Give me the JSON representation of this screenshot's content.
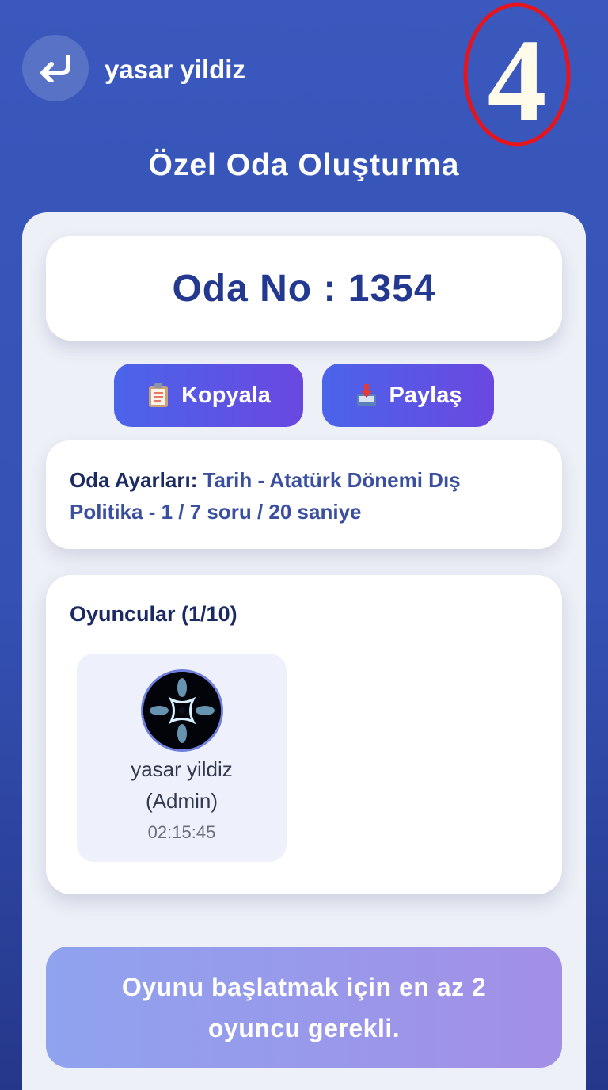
{
  "header": {
    "username": "yasar yildiz",
    "back_icon": "return-arrow-icon",
    "overlay_number": "4",
    "overlay_color": "#e8141c"
  },
  "page_title": "Özel Oda Oluşturma",
  "room": {
    "number_label": "Oda No : 1354"
  },
  "actions": {
    "copy_label": "Kopyala",
    "copy_icon": "clipboard-icon",
    "share_label": "Paylaş",
    "share_icon": "inbox-tray-icon"
  },
  "settings": {
    "label": "Oda Ayarları:",
    "value": "Tarih - Atatürk Dönemi Dış Politika - 1 / 7 soru / 20 saniye"
  },
  "players": {
    "title": "Oyuncular (1/10)",
    "list": [
      {
        "name": "yasar yildiz",
        "role": "(Admin)",
        "time": "02:15:45",
        "avatar_icon": "abstract-star-avatar"
      }
    ]
  },
  "start_notice": "Oyunu başlatmak için en az 2 oyuncu gerekli.",
  "colors": {
    "background": "#3451b3",
    "accent_text": "#23388f",
    "button_gradient_start": "#4b64ea",
    "button_gradient_end": "#6a48e0"
  }
}
